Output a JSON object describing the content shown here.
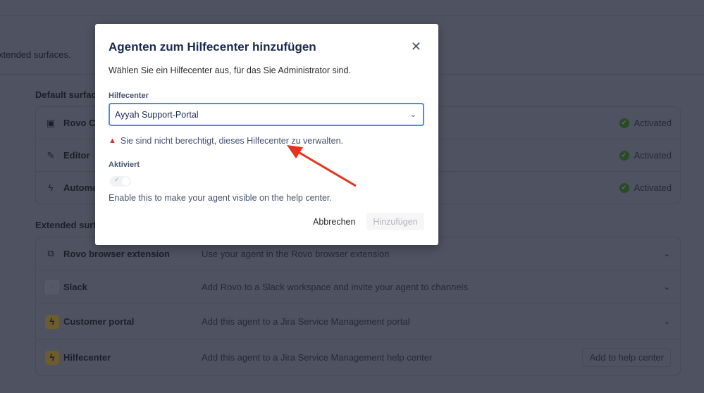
{
  "page": {
    "intro": "xtended surfaces.",
    "default_section": "Default surface",
    "default_rows": [
      {
        "icon": "chat-icon",
        "name": "Rovo Ch",
        "status": "Activated"
      },
      {
        "icon": "edit-icon",
        "name": "Editor",
        "status": "Activated"
      },
      {
        "icon": "lightning-icon",
        "name": "Automat",
        "status": "Activated"
      }
    ],
    "extended_section": "Extended surfa",
    "extended_rows": [
      {
        "icon": "puzzle-icon",
        "name": "Rovo browser extension",
        "desc": "Use your agent in the Rovo browser extension"
      },
      {
        "icon": "slack-icon",
        "name": "Slack",
        "desc": "Add Rovo to a Slack workspace and invite your agent to channels"
      },
      {
        "icon": "jsm-icon",
        "name": "Customer portal",
        "desc": "Add this agent to a Jira Service Management portal"
      },
      {
        "icon": "jsm-icon",
        "name": "Hilfecenter",
        "desc": "Add this agent to a Jira Service Management help center",
        "action": "Add to help center"
      }
    ]
  },
  "modal": {
    "title": "Agenten zum Hilfecenter hinzufügen",
    "subtitle": "Wählen Sie ein Hilfecenter aus, für das Sie Administrator sind.",
    "field_label": "Hilfecenter",
    "field_value": "Ayyah Support-Portal",
    "error": "Sie sind nicht berechtigt, dieses Hilfecenter zu verwalten.",
    "toggle_label": "Aktiviert",
    "toggle_on": false,
    "help": "Enable this to make your agent visible on the help center.",
    "cancel": "Abbrechen",
    "submit": "Hinzufügen"
  },
  "colors": {
    "accent": "#4c8af0",
    "error": "#c9372c",
    "annotation_arrow": "#e8321e",
    "success": "#2a4a2a"
  }
}
